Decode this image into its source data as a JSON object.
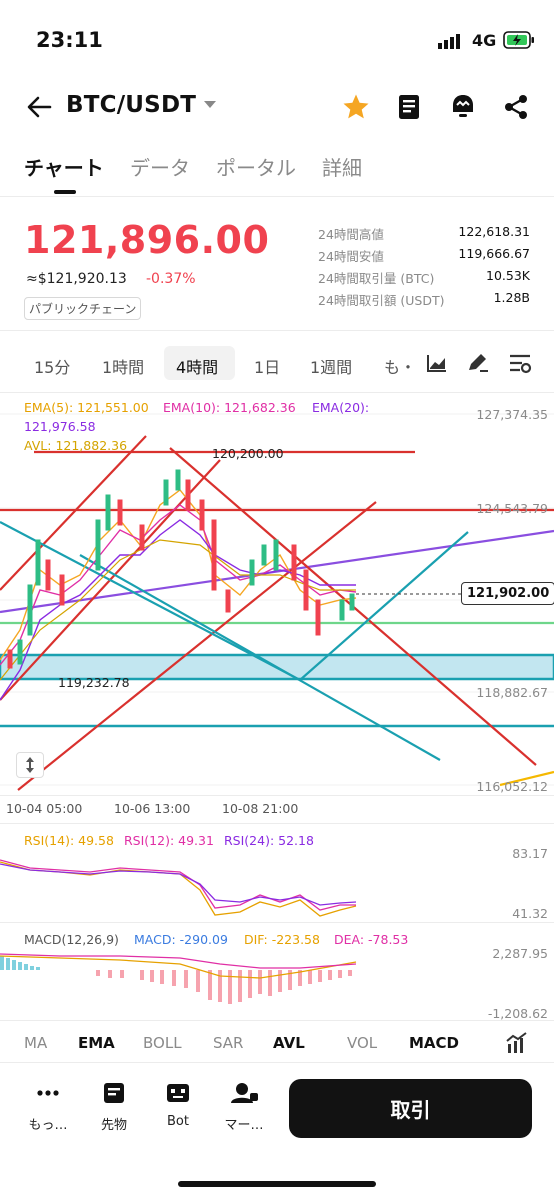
{
  "status_bar": {
    "time": "23:11",
    "network": "4G"
  },
  "header": {
    "pair": "BTC/USDT",
    "icons": [
      "back-arrow-icon",
      "dropdown-caret-icon",
      "star-icon",
      "book-icon",
      "alert-icon",
      "share-icon"
    ],
    "accent_color": "#f5a623"
  },
  "tabs": [
    "チャート",
    "データ",
    "ポータル",
    "詳細"
  ],
  "price": {
    "last": "121,896.00",
    "approx_usd": "≈$121,920.13",
    "change_pct": "-0.37%",
    "chain_badge": "パブリックチェーン",
    "down_color": "#f0424f"
  },
  "stats": [
    {
      "label": "24時間高値",
      "value": "122,618.31"
    },
    {
      "label": "24時間安値",
      "value": "119,666.67"
    },
    {
      "label": "24時間取引量 (BTC)",
      "value": "10.53K"
    },
    {
      "label": "24時間取引額 (USDT)",
      "value": "1.28B"
    }
  ],
  "timeframes": {
    "items": [
      "15分",
      "1時間",
      "4時間",
      "1日",
      "1週間",
      "も・"
    ],
    "active": "4時間"
  },
  "chart": {
    "ema5": "EMA(5): 121,551.00",
    "ema10": "EMA(10): 121,682.36",
    "ema20_label": "EMA(20):",
    "ema20_value": "121,976.58",
    "avl": "AVL: 121,882.36",
    "high_label": "120,200.00",
    "low_label": "119,232.78",
    "current_price_tag": "121,902.00",
    "y_axis": [
      "127,374.35",
      "124,543.79",
      "118,882.67",
      "116,052.12"
    ],
    "x_axis": [
      "10-04 05:00",
      "10-06 13:00",
      "10-08 21:00"
    ]
  },
  "rsi": {
    "rsi14": "RSI(14): 49.58",
    "rsi12": "RSI(12): 49.31",
    "rsi24": "RSI(24): 52.18",
    "axis_top": "83.17",
    "axis_bottom": "41.32"
  },
  "macd": {
    "title": "MACD(12,26,9)",
    "macd": "MACD: -290.09",
    "dif": "DIF: -223.58",
    "dea": "DEA: -78.53",
    "axis_top": "2,287.95",
    "axis_bottom": "-1,208.62"
  },
  "indicator_tabs": [
    {
      "label": "MA",
      "bold": false
    },
    {
      "label": "EMA",
      "bold": true
    },
    {
      "label": "BOLL",
      "bold": false
    },
    {
      "label": "SAR",
      "bold": false
    },
    {
      "label": "AVL",
      "bold": true
    },
    {
      "label": "VOL",
      "bold": false
    },
    {
      "label": "MACD",
      "bold": true
    }
  ],
  "bottom_nav": {
    "more": "もっ…",
    "futures": "先物",
    "bot": "Bot",
    "market": "マー…",
    "trade": "取引"
  }
}
